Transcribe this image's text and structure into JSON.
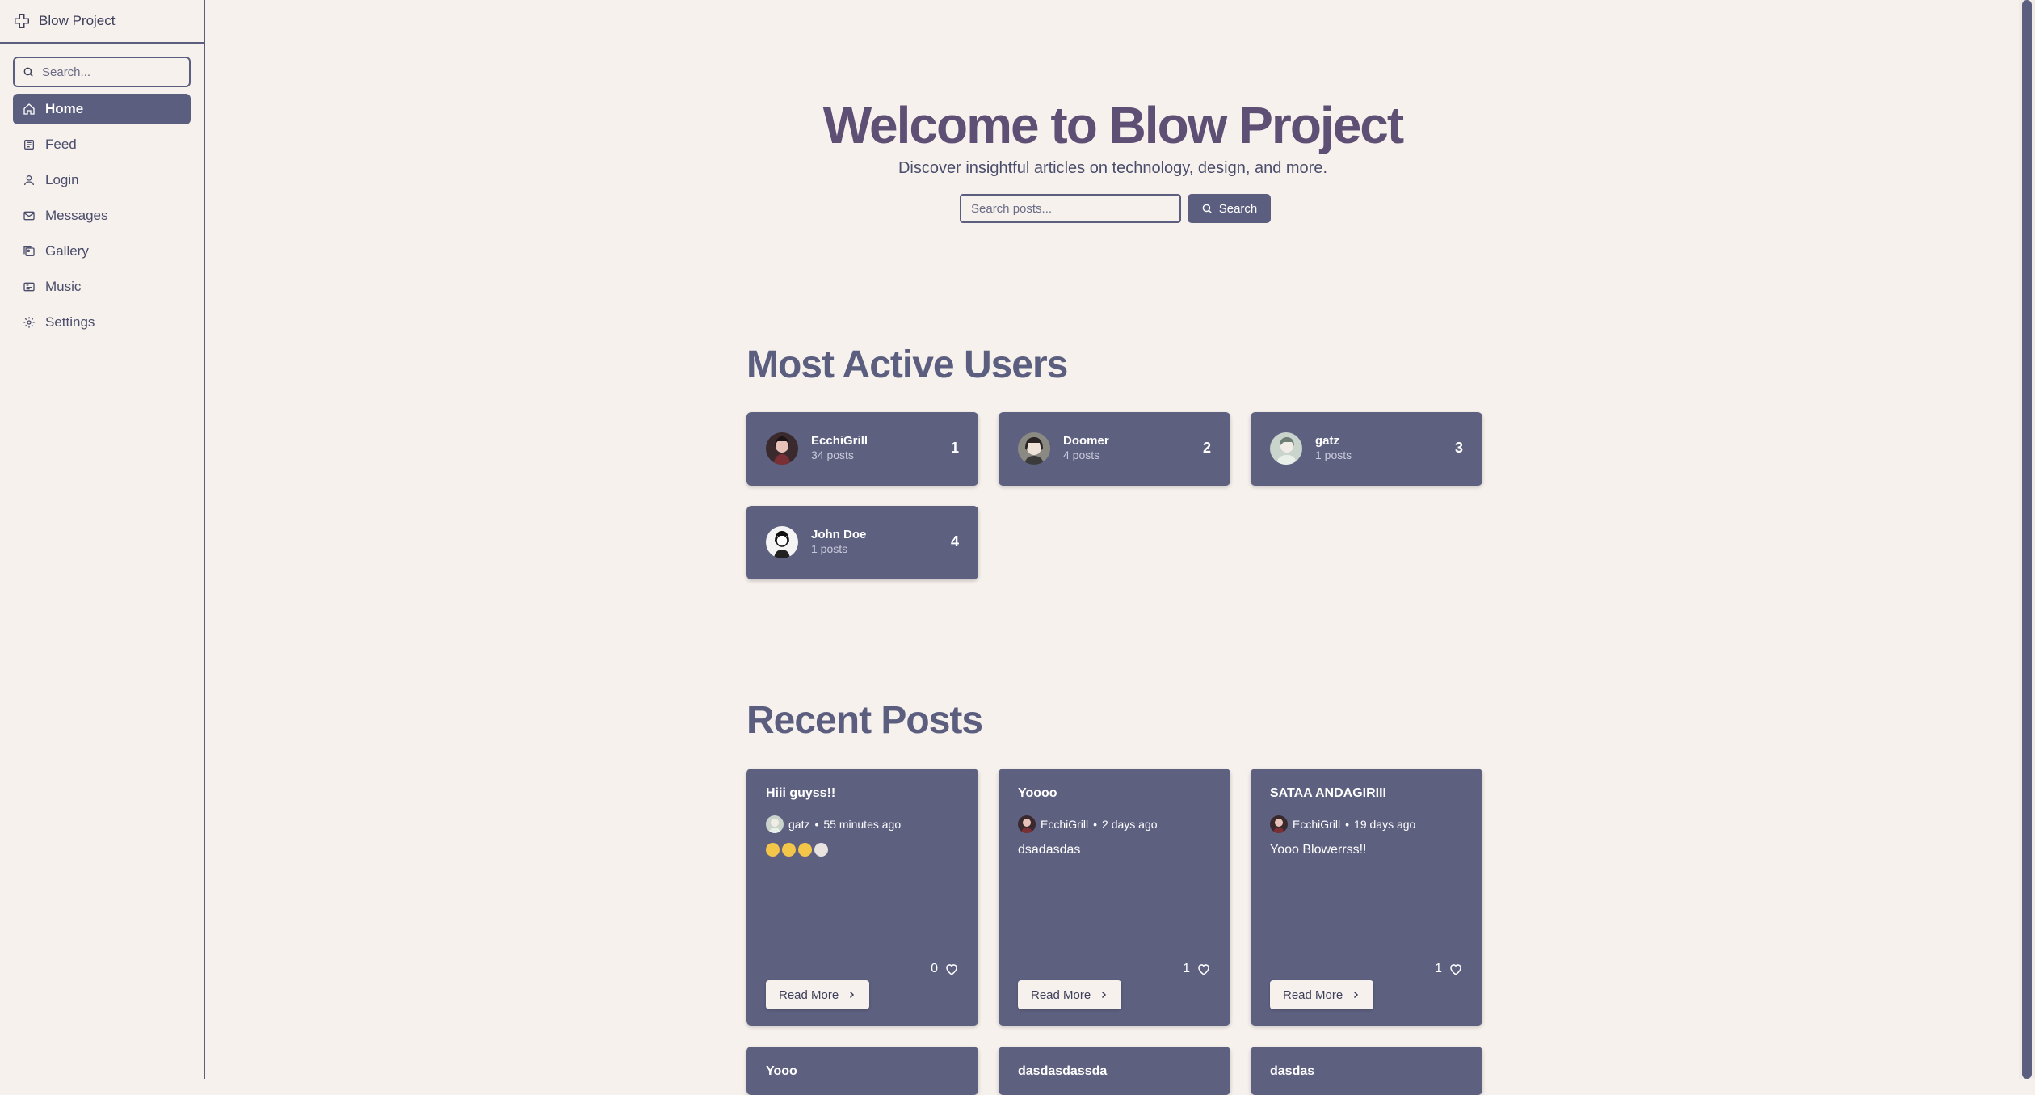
{
  "brand": {
    "name": "Blow Project"
  },
  "sidebar": {
    "search_placeholder": "Search...",
    "items": [
      {
        "label": "Home",
        "icon": "home-icon",
        "active": true
      },
      {
        "label": "Feed",
        "icon": "newspaper-icon"
      },
      {
        "label": "Login",
        "icon": "user-icon"
      },
      {
        "label": "Messages",
        "icon": "mail-icon"
      },
      {
        "label": "Gallery",
        "icon": "images-icon"
      },
      {
        "label": "Music",
        "icon": "music-icon"
      },
      {
        "label": "Settings",
        "icon": "gear-icon"
      }
    ]
  },
  "hero": {
    "title": "Welcome to Blow Project",
    "subtitle": "Discover insightful articles on technology, design, and more.",
    "search_placeholder": "Search posts...",
    "search_button": "Search"
  },
  "active_users": {
    "title": "Most Active Users",
    "users": [
      {
        "name": "EcchiGrill",
        "posts": "34 posts",
        "rank": "1"
      },
      {
        "name": "Doomer",
        "posts": "4 posts",
        "rank": "2"
      },
      {
        "name": "gatz",
        "posts": "1 posts",
        "rank": "3"
      },
      {
        "name": "John Doe",
        "posts": "1 posts",
        "rank": "4"
      }
    ]
  },
  "recent_posts": {
    "title": "Recent Posts",
    "read_more": "Read More",
    "posts": [
      {
        "title": "Hiii guyss!!",
        "author": "gatz",
        "time": "55 minutes ago",
        "body": "",
        "likes": "0"
      },
      {
        "title": "Yoooo",
        "author": "EcchiGrill",
        "time": "2 days ago",
        "body": "dsadasdas",
        "likes": "1"
      },
      {
        "title": "SATAA ANDAGIRIII",
        "author": "EcchiGrill",
        "time": "19 days ago",
        "body": "Yooo Blowerrss!!",
        "likes": "1"
      },
      {
        "title": "Yooo"
      },
      {
        "title": "dasdasdassda"
      },
      {
        "title": "dasdas"
      }
    ]
  },
  "colors": {
    "accent": "#5b5e7f",
    "card": "#5e6080",
    "background": "#f7f1ed",
    "heading": "#5e4f75"
  }
}
